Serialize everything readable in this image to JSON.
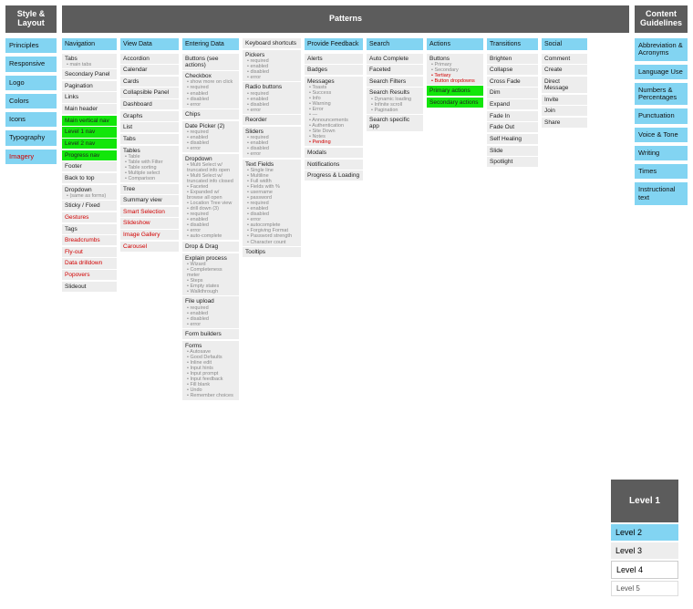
{
  "tabs": {
    "style": "Style & Layout",
    "patterns": "Patterns",
    "content": "Content Guidelines"
  },
  "styleCol": [
    {
      "t": "Principles"
    },
    {
      "t": "Responsive"
    },
    {
      "t": "Logo"
    },
    {
      "t": "Colors"
    },
    {
      "t": "Icons"
    },
    {
      "t": "Typography"
    },
    {
      "t": "Imagery",
      "red": true
    }
  ],
  "contentCol": [
    {
      "t": "Abbreviation & Acronyms"
    },
    {
      "t": "Language Use"
    },
    {
      "t": "Numbers & Percentages"
    },
    {
      "t": "Punctuation"
    },
    {
      "t": "Voice & Tone"
    },
    {
      "t": "Writing"
    },
    {
      "t": "Times"
    },
    {
      "t": "Instructional text"
    }
  ],
  "patterns": {
    "nav": {
      "h": "Navigation",
      "items": [
        {
          "t": "Tabs",
          "subs": [
            "main tabs"
          ]
        },
        {
          "t": "Secondary Panel"
        },
        {
          "t": "Pagination"
        },
        {
          "t": "Links"
        },
        {
          "t": "Main header"
        },
        {
          "t": "Main vertical nav",
          "green": true
        },
        {
          "t": "Level 1 nav",
          "green": true
        },
        {
          "t": "Level 2 nav",
          "green": true
        },
        {
          "t": "Progress nav",
          "green": true
        },
        {
          "t": "Footer"
        },
        {
          "t": "Back to top"
        },
        {
          "t": "Dropdown",
          "subs": [
            "(same as forms)"
          ]
        },
        {
          "t": "Sticky / Fixed"
        },
        {
          "t": "Gestures",
          "red": true
        },
        {
          "t": "Tags"
        },
        {
          "t": "Breadcrumbs",
          "red": true
        },
        {
          "t": "Fly-out",
          "red": true
        },
        {
          "t": "Data drilldown",
          "red": true
        },
        {
          "t": "Popovers",
          "red": true
        },
        {
          "t": "Slideout"
        }
      ]
    },
    "view": {
      "h": "View Data",
      "items": [
        {
          "t": "Accordion"
        },
        {
          "t": "Calendar"
        },
        {
          "t": "Cards"
        },
        {
          "t": "Collapsible Panel"
        },
        {
          "t": "Dashboard"
        },
        {
          "t": "Graphs"
        },
        {
          "t": "List"
        },
        {
          "t": "Tabs"
        },
        {
          "t": "Tables",
          "subs": [
            "Table",
            "Table with Filter",
            "Table sorting",
            "Multiple select",
            "Comparison"
          ]
        },
        {
          "t": "Tree"
        },
        {
          "t": "Summary view"
        },
        {
          "t": "Smart Selection",
          "red": true
        },
        {
          "t": "Slideshow",
          "red": true
        },
        {
          "t": "Image Gallery",
          "red": true
        },
        {
          "t": "Carousel",
          "red": true
        }
      ]
    },
    "enter": {
      "h": "Entering Data",
      "items": [
        {
          "t": "Buttons (see actions)"
        },
        {
          "t": "Checkbox",
          "subs": [
            "show more on click",
            "required",
            "enabled",
            "disabled",
            "error"
          ]
        },
        {
          "t": "Chips"
        },
        {
          "t": "Date Picker (2)",
          "subs": [
            "required",
            "enabled",
            "disabled",
            "error"
          ]
        },
        {
          "t": "Dropdown",
          "subs": [
            "Multi Select w/ truncated info open",
            "Multi Select w/ truncated info closed",
            "Faceted",
            "Expanded w/ browse all open",
            "Location Tree view",
            "drill down (3)",
            "required",
            "enabled",
            "disabled",
            "error",
            "auto-complete"
          ]
        },
        {
          "t": "Drop & Drag"
        },
        {
          "t": "Explain process",
          "subs": [
            "Wizard",
            "Completeness meter",
            "Steps",
            "Empty states",
            "Walkthrough"
          ]
        },
        {
          "t": "File upload",
          "subs": [
            "required",
            "enabled",
            "disabled",
            "error"
          ]
        },
        {
          "t": "Form builders"
        },
        {
          "t": "Forms",
          "subs": [
            "Autosave",
            "Good Defaults",
            "Inline edit",
            "Input hints",
            "Input prompt",
            "Input feedback",
            "Fill blank",
            "Undo",
            "Remember choices"
          ]
        }
      ]
    },
    "enter2": [
      {
        "t": "Keyboard shortcuts"
      },
      {
        "t": "Pickers",
        "subs": [
          "required",
          "enabled",
          "disabled",
          "error"
        ]
      },
      {
        "t": "Radio buttons",
        "subs": [
          "required",
          "enabled",
          "disabled",
          "error"
        ]
      },
      {
        "t": "Reorder"
      },
      {
        "t": "Sliders",
        "subs": [
          "required",
          "enabled",
          "disabled",
          "error"
        ]
      },
      {
        "t": "Text Fields",
        "subs": [
          "Single line",
          "Multiline",
          "Full width",
          "Fields with %",
          "username",
          "password",
          "required",
          "enabled",
          "disabled",
          "error",
          "autocomplete",
          "Forgiving Format",
          "Password strength",
          "Character count"
        ]
      },
      {
        "t": "Tooltips"
      }
    ],
    "feed": {
      "h": "Provide Feedback",
      "items": [
        {
          "t": "Alerts"
        },
        {
          "t": "Badges"
        },
        {
          "t": "Messages",
          "subs": [
            "Toasts",
            "Success",
            "Info",
            "Warning",
            "Error",
            "—",
            "Announcements",
            "Authentication",
            "Site Down",
            "Notes",
            {
              "t": "Pending",
              "red": true
            }
          ]
        },
        {
          "t": "Modals"
        },
        {
          "t": "Notifications"
        },
        {
          "t": "Progress & Loading"
        }
      ]
    },
    "search": {
      "h": "Search",
      "items": [
        {
          "t": "Auto Complete"
        },
        {
          "t": "Faceted"
        },
        {
          "t": "Search Filters"
        },
        {
          "t": "Search Results",
          "subs": [
            "Dynamic loading",
            "Infinite scroll",
            "Pagination"
          ]
        },
        {
          "t": "Search specific app"
        }
      ]
    },
    "actions": {
      "h": "Actions",
      "items": [
        {
          "t": "Buttons",
          "subs": [
            "Primary",
            "Secondary",
            {
              "t": "Tertiary",
              "red": true
            },
            {
              "t": "Button dropdowns",
              "red": true
            }
          ]
        },
        {
          "t": "Primary actions",
          "green": true
        },
        {
          "t": "Secondary actions",
          "green": true
        }
      ]
    },
    "trans": {
      "h": "Transitions",
      "items": [
        {
          "t": "Brighten"
        },
        {
          "t": "Collapse"
        },
        {
          "t": "Cross Fade"
        },
        {
          "t": "Dim"
        },
        {
          "t": "Expand"
        },
        {
          "t": "Fade In"
        },
        {
          "t": "Fade Out"
        },
        {
          "t": "Self Healing"
        },
        {
          "t": "Slide"
        },
        {
          "t": "Spotlight"
        }
      ]
    },
    "social": {
      "h": "Social",
      "items": [
        {
          "t": "Comment"
        },
        {
          "t": "Create"
        },
        {
          "t": "Direct Message"
        },
        {
          "t": "Invite"
        },
        {
          "t": "Join"
        },
        {
          "t": "Share"
        }
      ]
    }
  },
  "legend": {
    "l1": "Level 1",
    "l2": "Level 2",
    "l3": "Level 3",
    "l4": "Level 4",
    "l5": "Level 5"
  }
}
